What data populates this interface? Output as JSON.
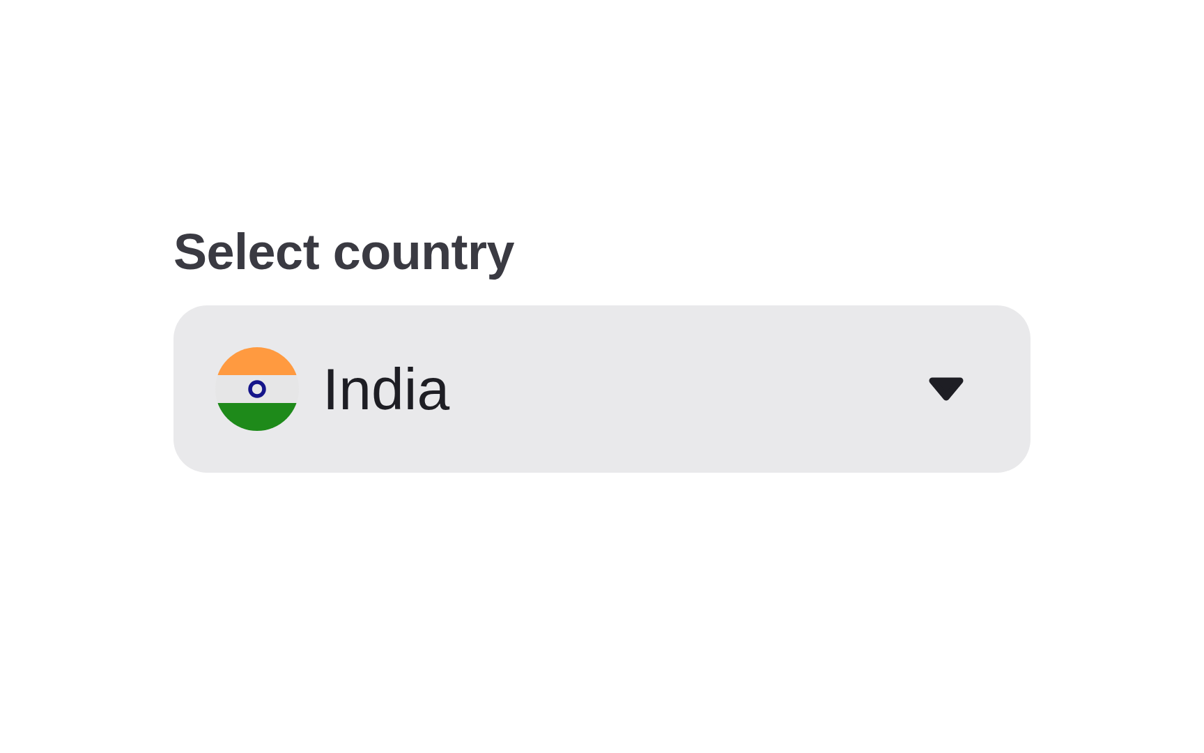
{
  "label": "Select country",
  "select": {
    "value": "India"
  }
}
